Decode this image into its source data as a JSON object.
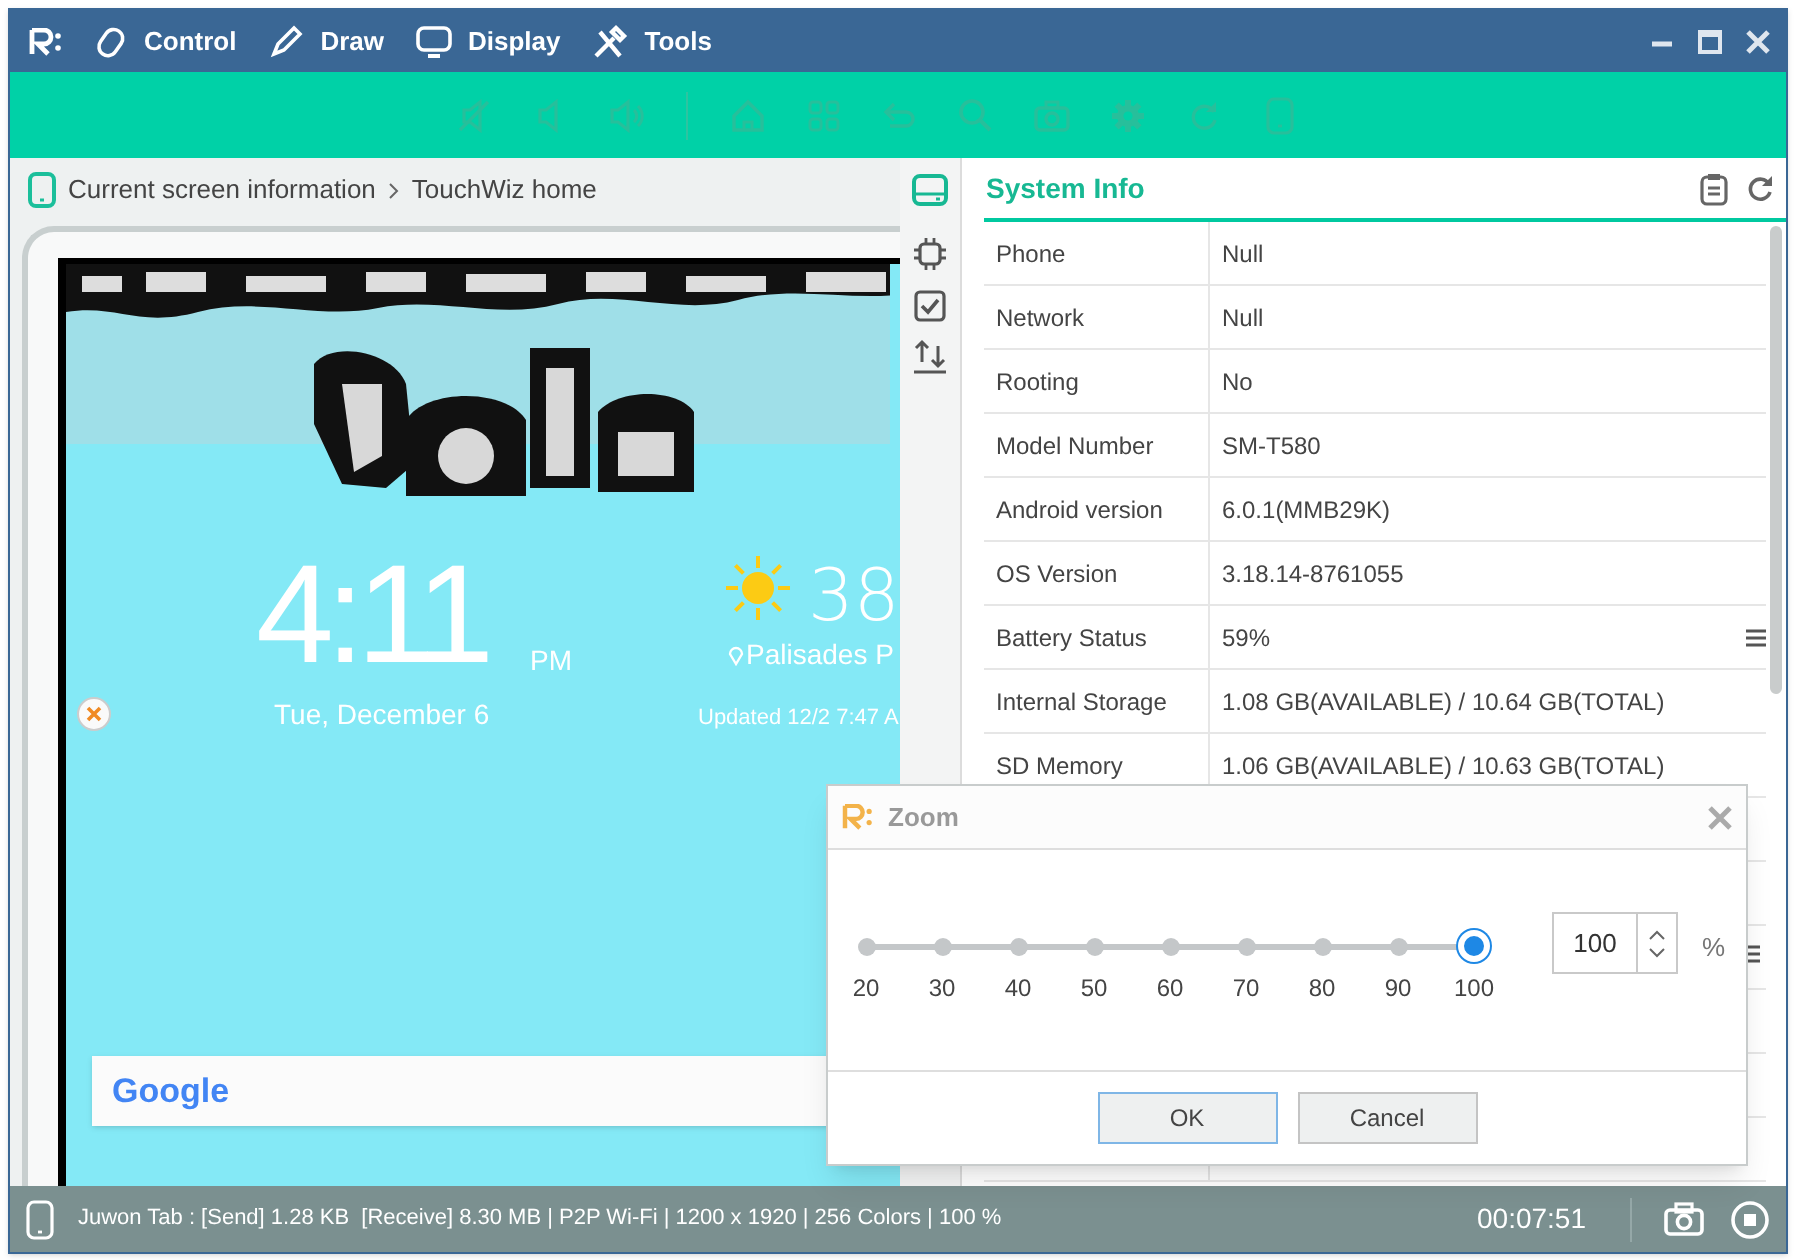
{
  "menu": [
    {
      "label": "Control"
    },
    {
      "label": "Draw"
    },
    {
      "label": "Display"
    },
    {
      "label": "Tools"
    }
  ],
  "breadcrumb": {
    "path": "Current screen information",
    "current": "TouchWiz home"
  },
  "device_screen": {
    "time": "4:11",
    "ampm": "PM",
    "date": "Tue, December 6",
    "temperature": "38",
    "location": "Palisades P",
    "updated": "Updated 12/2 7:47 A",
    "search_logo": "Google"
  },
  "side_tabs": [
    {
      "kind": "storage",
      "selected": true
    },
    {
      "kind": "chip",
      "selected": false
    },
    {
      "kind": "check",
      "selected": false
    },
    {
      "kind": "transfer",
      "selected": false
    }
  ],
  "system_info": {
    "title": "System Info",
    "rows": [
      {
        "label": "Phone",
        "value": "Null",
        "menu": false
      },
      {
        "label": "Network",
        "value": "Null",
        "menu": false
      },
      {
        "label": "Rooting",
        "value": "No",
        "menu": false
      },
      {
        "label": "Model Number",
        "value": "SM-T580",
        "menu": false
      },
      {
        "label": "Android version",
        "value": "6.0.1(MMB29K)",
        "menu": false
      },
      {
        "label": "OS Version",
        "value": "3.18.14-8761055",
        "menu": false
      },
      {
        "label": "Battery Status",
        "value": "59%",
        "menu": true
      },
      {
        "label": "Internal Storage",
        "value": "1.08 GB(AVAILABLE) / 10.64 GB(TOTAL)",
        "menu": false
      },
      {
        "label": "SD Memory",
        "value": "1.06 GB(AVAILABLE) / 10.63 GB(TOTAL)",
        "menu": false
      }
    ]
  },
  "zoom_dialog": {
    "title": "Zoom",
    "stops": [
      {
        "label": "20",
        "selected": false
      },
      {
        "label": "30",
        "selected": false
      },
      {
        "label": "40",
        "selected": false
      },
      {
        "label": "50",
        "selected": false
      },
      {
        "label": "60",
        "selected": false
      },
      {
        "label": "70",
        "selected": false
      },
      {
        "label": "80",
        "selected": false
      },
      {
        "label": "90",
        "selected": false
      },
      {
        "label": "100",
        "selected": true
      }
    ],
    "value": "100",
    "unit": "%",
    "buttons": [
      {
        "label": "OK",
        "selected": true
      },
      {
        "label": "Cancel",
        "selected": false
      }
    ]
  },
  "status_bar": {
    "text": "Juwon Tab : [Send] 1.28 KB  [Receive] 8.30 MB | P2P Wi-Fi | 1200 x 1920 | 256 Colors | 100 %",
    "timer": "00:07:51"
  }
}
